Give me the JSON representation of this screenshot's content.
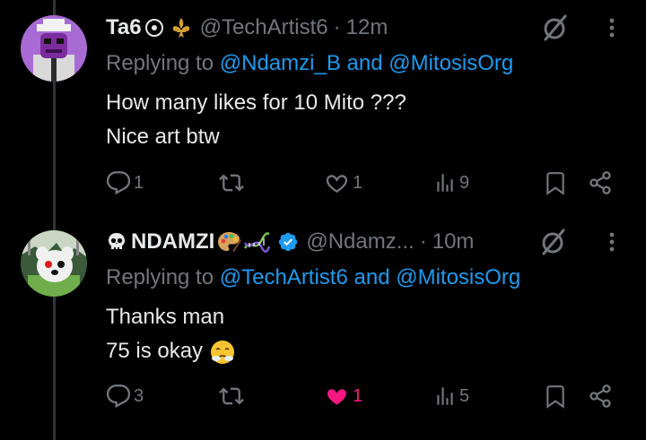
{
  "posts": [
    {
      "display_name": "Ta6",
      "handle": "@TechArtist6",
      "separator": "·",
      "time": "12m",
      "replying_prefix": "Replying to ",
      "replying_mention_1": "@Ndamzi_B",
      "replying_and": " and ",
      "replying_mention_2": "@MitosisOrg",
      "text_line_1": "How many likes for 10 Mito ???",
      "text_line_2": "Nice art btw",
      "replies": "1",
      "reposts": "",
      "likes": "1",
      "views": "9",
      "liked": false
    },
    {
      "display_name": "NDAMZI",
      "handle": "@Ndamz...",
      "separator": "·",
      "time": "10m",
      "verified": true,
      "replying_prefix": "Replying to ",
      "replying_mention_1": "@TechArtist6",
      "replying_and": " and ",
      "replying_mention_2": "@MitosisOrg",
      "text_line_1": "Thanks man",
      "text_line_2": "75 is okay",
      "replies": "3",
      "reposts": "",
      "likes": "1",
      "views": "5",
      "liked": true
    }
  ],
  "colors": {
    "background": "#000000",
    "primary_text": "#e7e9ea",
    "secondary_text": "#71767b",
    "mention": "#1d9bf0",
    "like": "#f91880",
    "verified": "#1d9bf0",
    "thread_line": "#333639"
  },
  "icons": [
    "reply-icon",
    "repost-icon",
    "heart-icon",
    "views-icon",
    "bookmark-icon",
    "share-icon",
    "grok-icon",
    "more-icon",
    "verified-icon",
    "skull-icon",
    "palette-icon",
    "dna-icon",
    "fleur-de-lis-icon",
    "circle-dot-icon",
    "steam-nose-emoji"
  ]
}
